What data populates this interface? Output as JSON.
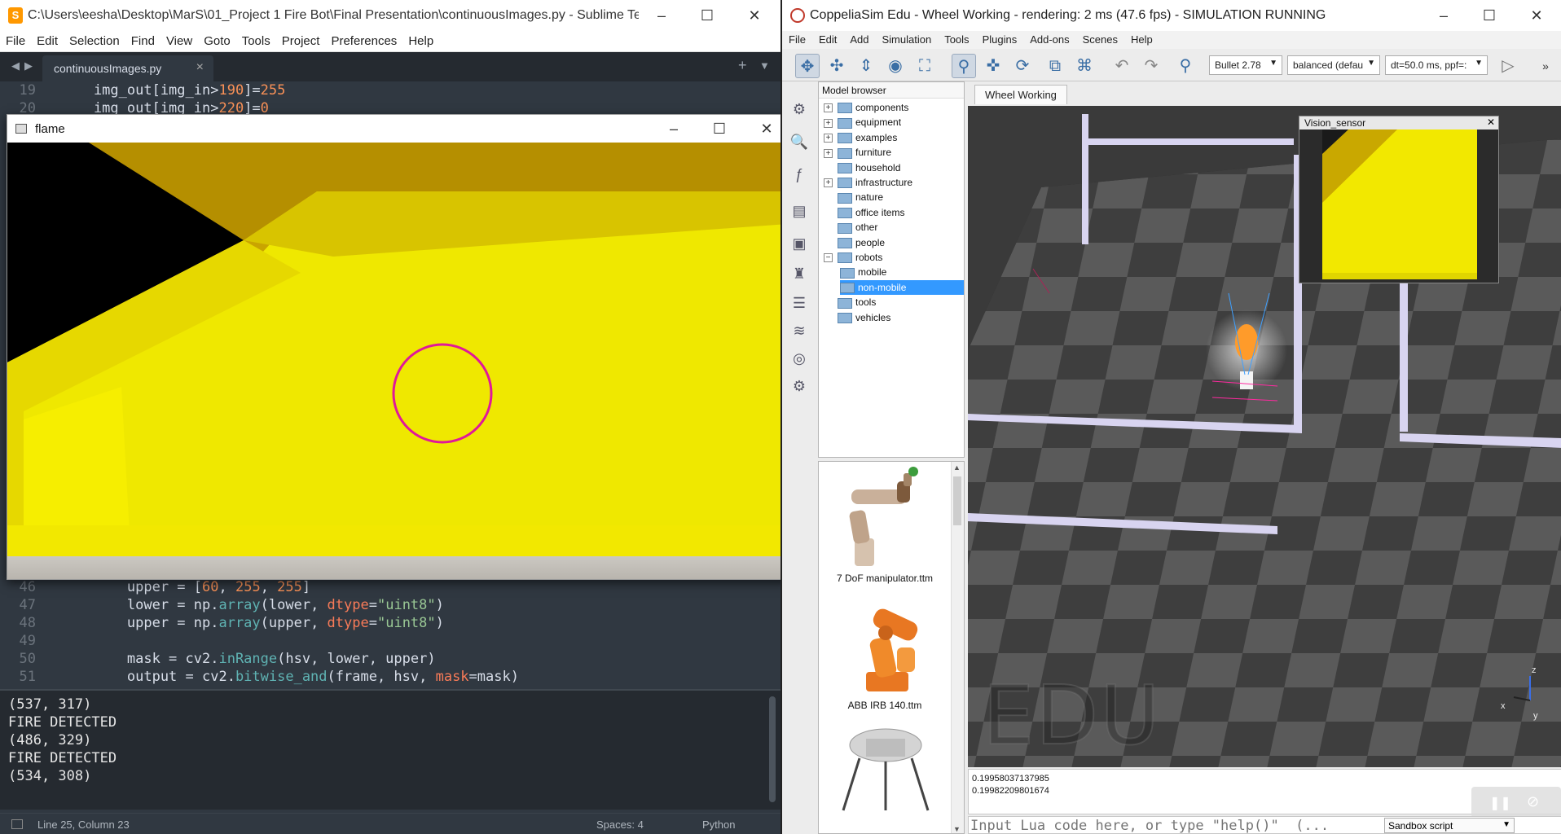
{
  "sublime": {
    "title": "C:\\Users\\eesha\\Desktop\\MarS\\01_Project 1 Fire Bot\\Final Presentation\\continuousImages.py - Sublime Text (UN...",
    "menu": [
      "File",
      "Edit",
      "Selection",
      "Find",
      "View",
      "Goto",
      "Tools",
      "Project",
      "Preferences",
      "Help"
    ],
    "tab": "continuousImages.py",
    "code_top": [
      {
        "ln": "19",
        "code": "    img_out[img_in>190]=255"
      },
      {
        "ln": "20",
        "code": "    img_out[img_in>220]=0"
      }
    ],
    "code_bottom": [
      {
        "ln": "46",
        "code": "        upper = [60, 255, 255]"
      },
      {
        "ln": "47",
        "code": "        lower = np.array(lower, dtype=\"uint8\")"
      },
      {
        "ln": "48",
        "code": "        upper = np.array(upper, dtype=\"uint8\")"
      },
      {
        "ln": "49",
        "code": ""
      },
      {
        "ln": "50",
        "code": "        mask = cv2.inRange(hsv, lower, upper)"
      },
      {
        "ln": "51",
        "code": "        output = cv2.bitwise_and(frame, hsv, mask=mask)"
      }
    ],
    "console": [
      "(537, 317)",
      "FIRE DETECTED",
      "(486, 329)",
      "FIRE DETECTED",
      "(534, 308)"
    ],
    "status": {
      "position": "Line 25, Column 23",
      "spaces": "Spaces: 4",
      "syntax": "Python"
    }
  },
  "flame": {
    "title": "flame",
    "circle_color": "#e0189a"
  },
  "coppelia": {
    "title": "CoppeliaSim Edu - Wheel Working - rendering: 2 ms (47.6 fps) - SIMULATION RUNNING",
    "menu": [
      "File",
      "Edit",
      "Add",
      "Simulation",
      "Tools",
      "Plugins",
      "Add-ons",
      "Scenes",
      "Help"
    ],
    "engine": "Bullet 2.78",
    "accuracy": "balanced (defau",
    "timestep": "dt=50.0 ms, ppf=:",
    "model_browser": {
      "title": "Model browser",
      "items": [
        {
          "label": "components",
          "expandable": true,
          "indent": 0
        },
        {
          "label": "equipment",
          "expandable": true,
          "indent": 0
        },
        {
          "label": "examples",
          "expandable": true,
          "indent": 0
        },
        {
          "label": "furniture",
          "expandable": true,
          "indent": 0
        },
        {
          "label": "household",
          "expandable": false,
          "indent": 0
        },
        {
          "label": "infrastructure",
          "expandable": true,
          "indent": 0
        },
        {
          "label": "nature",
          "expandable": false,
          "indent": 0
        },
        {
          "label": "office items",
          "expandable": false,
          "indent": 0
        },
        {
          "label": "other",
          "expandable": false,
          "indent": 0
        },
        {
          "label": "people",
          "expandable": false,
          "indent": 0
        },
        {
          "label": "robots",
          "expandable": true,
          "indent": 0
        },
        {
          "label": "mobile",
          "expandable": false,
          "indent": 1
        },
        {
          "label": "non-mobile",
          "expandable": false,
          "indent": 1,
          "selected": true
        },
        {
          "label": "tools",
          "expandable": false,
          "indent": 0
        },
        {
          "label": "vehicles",
          "expandable": false,
          "indent": 0
        }
      ],
      "thumbnails": [
        "7 DoF manipulator.ttm",
        "ABB IRB 140.ttm"
      ]
    },
    "scene_tab": "Wheel Working",
    "vision_sensor_title": "Vision_sensor",
    "watermark": "EDU",
    "axis_labels": {
      "x": "x",
      "z": "z",
      "y": "y"
    },
    "output": [
      "0.19958037137985",
      "0.19982209801674"
    ],
    "command_placeholder": "Input Lua code here, or type \"help()\"  (...",
    "script_mode": "Sandbox script"
  }
}
